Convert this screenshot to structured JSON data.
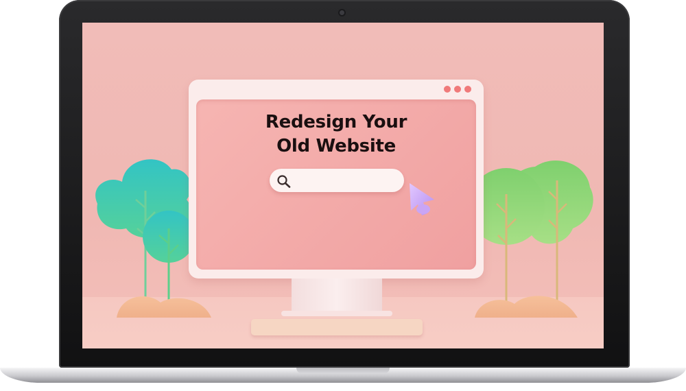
{
  "hero": {
    "title_line1": "Redesign Your",
    "title_line2": "Old Website"
  },
  "search": {
    "icon": "search-icon"
  },
  "window_controls": [
    "dot",
    "dot",
    "dot"
  ],
  "colors": {
    "screen_bg": "#f1bcb8",
    "monitor_frame": "#fbeceb",
    "display": "#f0a0a0",
    "cursor": "#c8a8f0",
    "tree_teal": "#3fc7b7",
    "tree_green": "#8fd67a",
    "control_dots": "#f07a7a"
  }
}
